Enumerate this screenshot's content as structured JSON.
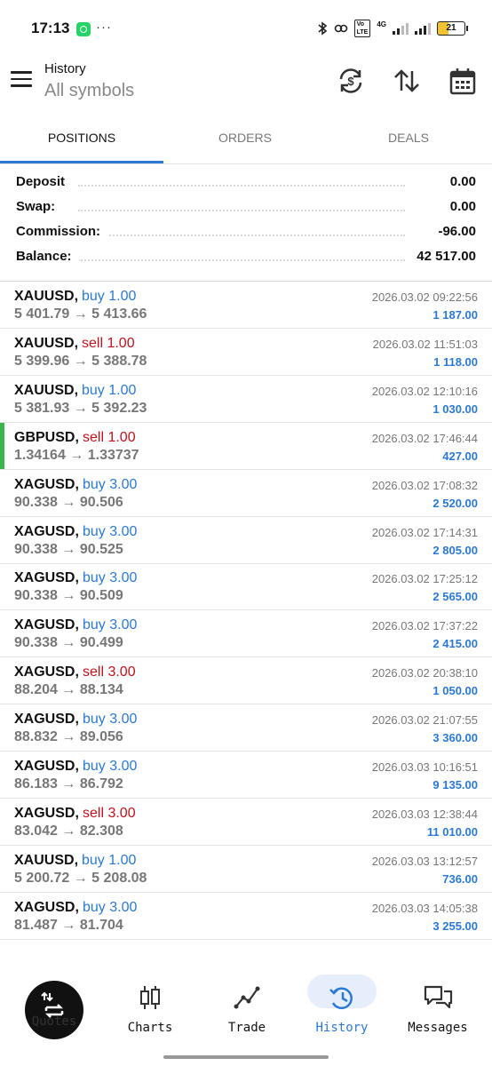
{
  "status_bar": {
    "time": "17:13",
    "dots": "···",
    "network_label": "4G",
    "battery": "21"
  },
  "app_bar": {
    "title": "History",
    "subtitle": "All symbols",
    "icons": [
      "menu-icon",
      "currency-sync-icon",
      "sort-icon",
      "calendar-icon"
    ]
  },
  "tabs": [
    {
      "label": "POSITIONS",
      "active": true
    },
    {
      "label": "ORDERS",
      "active": false
    },
    {
      "label": "DEALS",
      "active": false
    }
  ],
  "summary": [
    {
      "label": "Deposit",
      "value": "0.00"
    },
    {
      "label": "Swap:",
      "value": "0.00"
    },
    {
      "label": "Commission:",
      "value": "-96.00"
    },
    {
      "label": "Balance:",
      "value": "42 517.00"
    }
  ],
  "positions": [
    {
      "symbol": "XAUUSD,",
      "side": "buy 1.00",
      "type": "buy",
      "prices": "5 401.79 → 5 413.66",
      "time": "2026.03.02 09:22:56",
      "profit": "1 187.00"
    },
    {
      "symbol": "XAUUSD,",
      "side": "sell 1.00",
      "type": "sell",
      "prices": "5 399.96 → 5 388.78",
      "time": "2026.03.02 11:51:03",
      "profit": "1 118.00"
    },
    {
      "symbol": "XAUUSD,",
      "side": "buy 1.00",
      "type": "buy",
      "prices": "5 381.93 → 5 392.23",
      "time": "2026.03.02 12:10:16",
      "profit": "1 030.00"
    },
    {
      "symbol": "GBPUSD,",
      "side": "sell 1.00",
      "type": "sell",
      "prices": "1.34164 → 1.33737",
      "time": "2026.03.02 17:46:44",
      "profit": "427.00",
      "highlighted": true
    },
    {
      "symbol": "XAGUSD,",
      "side": "buy 3.00",
      "type": "buy",
      "prices": "90.338 → 90.506",
      "time": "2026.03.02 17:08:32",
      "profit": "2 520.00"
    },
    {
      "symbol": "XAGUSD,",
      "side": "buy 3.00",
      "type": "buy",
      "prices": "90.338 → 90.525",
      "time": "2026.03.02 17:14:31",
      "profit": "2 805.00"
    },
    {
      "symbol": "XAGUSD,",
      "side": "buy 3.00",
      "type": "buy",
      "prices": "90.338 → 90.509",
      "time": "2026.03.02 17:25:12",
      "profit": "2 565.00"
    },
    {
      "symbol": "XAGUSD,",
      "side": "buy 3.00",
      "type": "buy",
      "prices": "90.338 → 90.499",
      "time": "2026.03.02 17:37:22",
      "profit": "2 415.00"
    },
    {
      "symbol": "XAGUSD,",
      "side": "sell 3.00",
      "type": "sell",
      "prices": "88.204 → 88.134",
      "time": "2026.03.02 20:38:10",
      "profit": "1 050.00"
    },
    {
      "symbol": "XAGUSD,",
      "side": "buy 3.00",
      "type": "buy",
      "prices": "88.832 → 89.056",
      "time": "2026.03.02 21:07:55",
      "profit": "3 360.00"
    },
    {
      "symbol": "XAGUSD,",
      "side": "buy 3.00",
      "type": "buy",
      "prices": "86.183 → 86.792",
      "time": "2026.03.03 10:16:51",
      "profit": "9 135.00"
    },
    {
      "symbol": "XAGUSD,",
      "side": "sell 3.00",
      "type": "sell",
      "prices": "83.042 → 82.308",
      "time": "2026.03.03 12:38:44",
      "profit": "11 010.00"
    },
    {
      "symbol": "XAUUSD,",
      "side": "buy 1.00",
      "type": "buy",
      "prices": "5 200.72 → 5 208.08",
      "time": "2026.03.03 13:12:57",
      "profit": "736.00"
    },
    {
      "symbol": "XAGUSD,",
      "side": "buy 3.00",
      "type": "buy",
      "prices": "81.487 → 81.704",
      "time": "2026.03.03 14:05:38",
      "profit": "3 255.00"
    }
  ],
  "bottom_nav": {
    "quotes": {
      "label": "Quotes",
      "icon": "quotes-icon"
    },
    "items": [
      {
        "label": "Charts",
        "icon": "candlestick-icon",
        "active": false
      },
      {
        "label": "Trade",
        "icon": "trend-line-icon",
        "active": false
      },
      {
        "label": "History",
        "icon": "history-icon",
        "active": true
      },
      {
        "label": "Messages",
        "icon": "chat-bubbles-icon",
        "active": false
      }
    ]
  },
  "colors": {
    "accent": "#2b79d4",
    "buy": "#2b79d4",
    "sell": "#c1121c",
    "highlight_marker": "#3bb54a",
    "muted_text": "#777777"
  }
}
